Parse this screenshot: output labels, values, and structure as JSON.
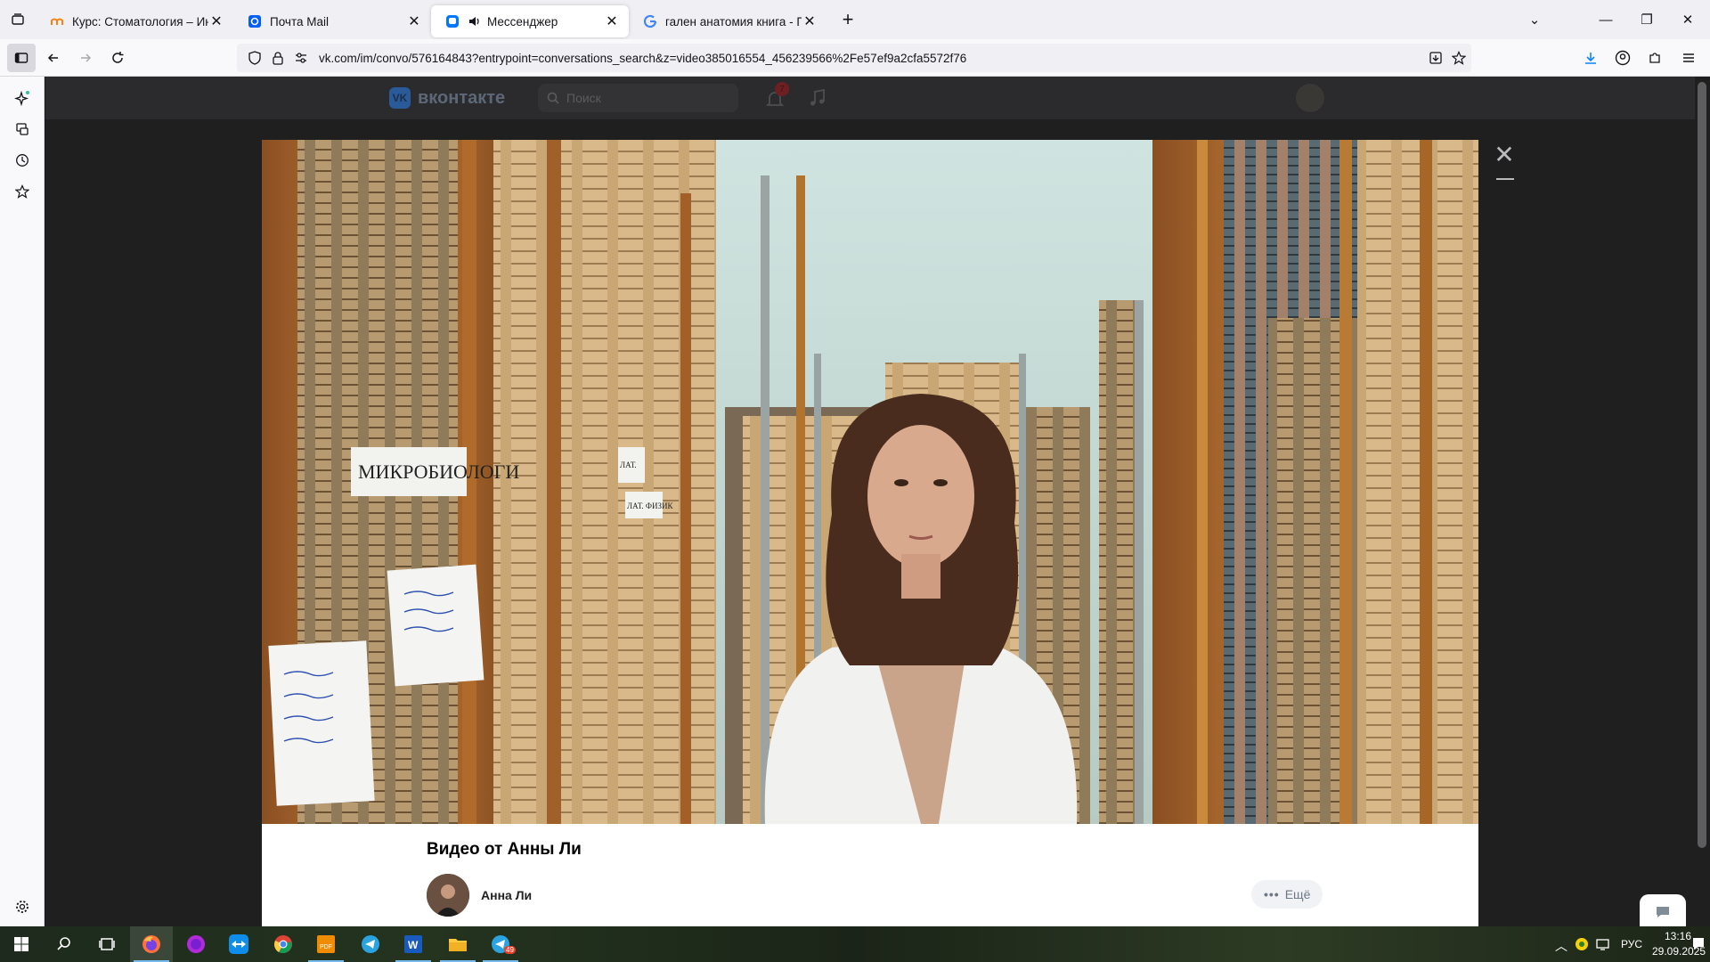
{
  "browser": {
    "tabs": [
      {
        "title": "Курс: Стоматология – Иностра",
        "active": false,
        "icon": "moodle-icon"
      },
      {
        "title": "Почта Mail",
        "active": false,
        "icon": "mail-icon"
      },
      {
        "title": "Мессенджер",
        "active": true,
        "icon": "vk-messenger-icon"
      },
      {
        "title": "гален анатомия книга - Поиск",
        "active": false,
        "icon": "google-icon"
      }
    ],
    "url": "vk.com/im/convo/576164843?entrypoint=conversations_search&z=video385016554_456239566%2Fe57ef9a2cfa5572f76"
  },
  "vk": {
    "logo_text": "вконтакте",
    "search_placeholder": "Поиск",
    "notification_count": "7"
  },
  "video": {
    "title": "Видео от Анны Ли",
    "author": "Анна Ли",
    "more_label": "Ещё",
    "sign_main": "МИКРОБИОЛОГИ",
    "sign_small1": "ЛАТ.",
    "sign_small2": "ЛАТ. ФИЗИК"
  },
  "taskbar": {
    "lang": "РУС",
    "time": "13:16",
    "date": "29.09.2025",
    "telegram_badge": "49"
  },
  "colors": {
    "accent": "#0a84ff",
    "vk_blue": "#2787f5"
  }
}
